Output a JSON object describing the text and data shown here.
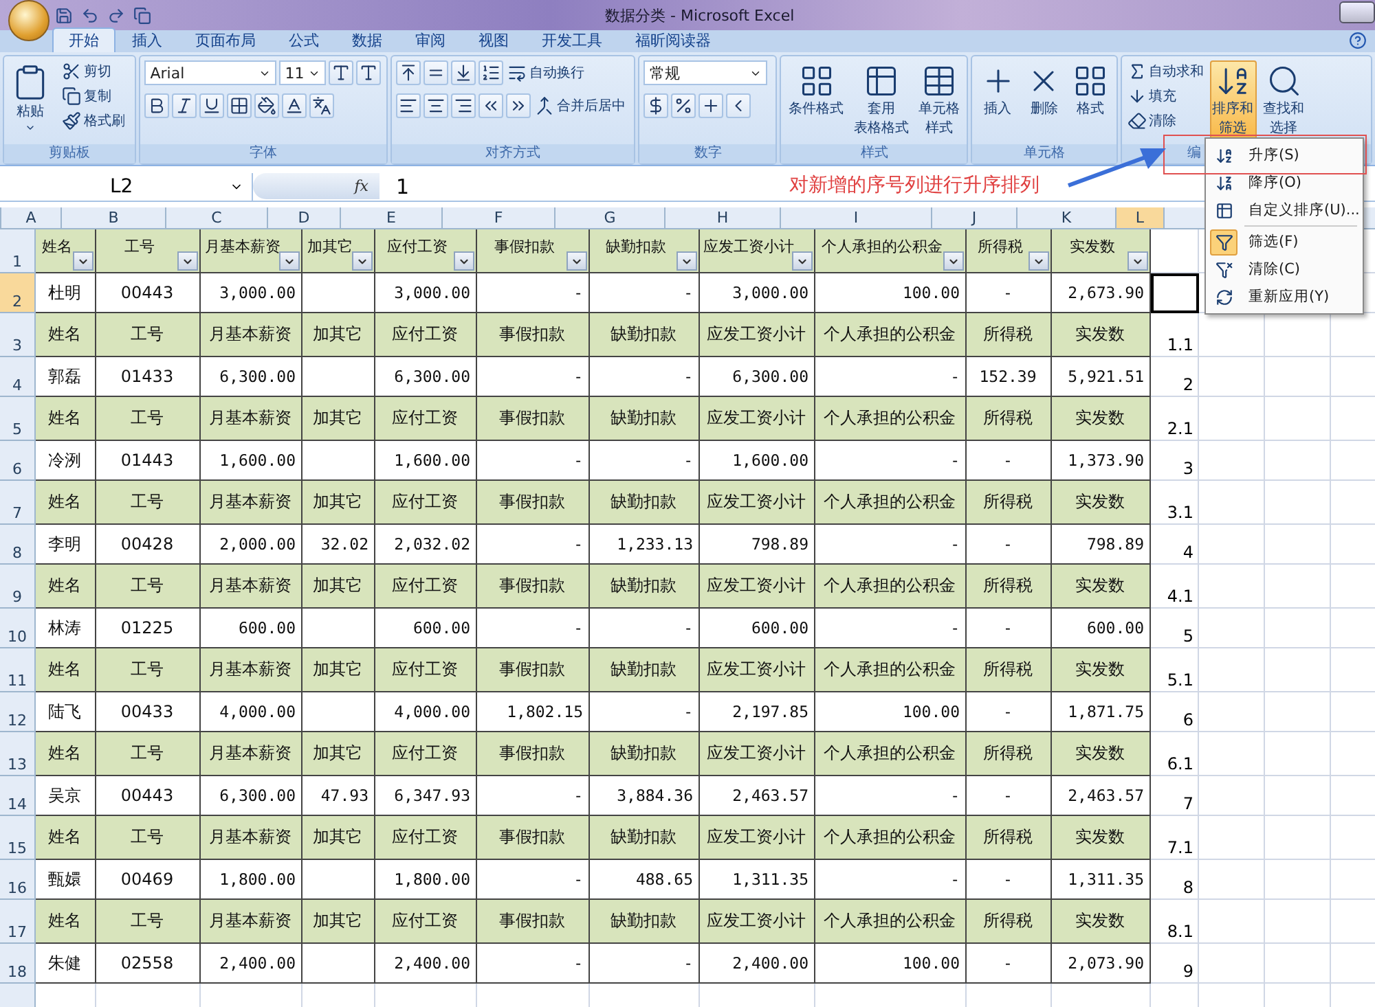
{
  "window": {
    "title": "数据分类 - Microsoft Excel"
  },
  "tabs": [
    {
      "label": "开始",
      "selected": true
    },
    {
      "label": "插入",
      "selected": false
    },
    {
      "label": "页面布局",
      "selected": false
    },
    {
      "label": "公式",
      "selected": false
    },
    {
      "label": "数据",
      "selected": false
    },
    {
      "label": "审阅",
      "selected": false
    },
    {
      "label": "视图",
      "selected": false
    },
    {
      "label": "开发工具",
      "selected": false
    },
    {
      "label": "福昕阅读器",
      "selected": false
    }
  ],
  "ribbon": [
    {
      "kind": "clipboard",
      "label": "剪贴板",
      "large": [
        "粘贴"
      ],
      "small": [
        "剪切",
        "复制",
        "格式刷"
      ]
    },
    {
      "kind": "font",
      "label": "字体",
      "font": "Arial",
      "size": "11"
    },
    {
      "kind": "alignment",
      "label": "对齐方式",
      "small": [
        "自动换行",
        "合并后居中"
      ]
    },
    {
      "kind": "number",
      "label": "数字",
      "format": "常规"
    },
    {
      "kind": "styles",
      "label": "样式",
      "large": [
        {
          "lines": [
            "条件格式"
          ],
          "active": false
        },
        {
          "lines": [
            "套用",
            "表格格式"
          ],
          "active": false
        },
        {
          "lines": [
            "单元格",
            "样式"
          ],
          "active": false
        }
      ]
    },
    {
      "kind": "cells",
      "label": "单元格",
      "large": [
        {
          "lines": [
            "插入"
          ],
          "active": false
        },
        {
          "lines": [
            "删除"
          ],
          "active": false
        },
        {
          "lines": [
            "格式"
          ],
          "active": false
        }
      ]
    },
    {
      "kind": "editing",
      "label": "编",
      "small": [
        "自动求和",
        "填充",
        "清除"
      ],
      "large": [
        {
          "lines": [
            "排序和",
            "筛选"
          ],
          "active": true
        },
        {
          "lines": [
            "查找和",
            "选择"
          ],
          "active": false
        }
      ]
    }
  ],
  "formula_bar": {
    "name_box": "L2",
    "fx_label": "fx",
    "value": "1"
  },
  "columns": [
    {
      "label": "A",
      "selected": false
    },
    {
      "label": "B",
      "selected": false
    },
    {
      "label": "C",
      "selected": false
    },
    {
      "label": "D",
      "selected": false
    },
    {
      "label": "E",
      "selected": false
    },
    {
      "label": "F",
      "selected": false
    },
    {
      "label": "G",
      "selected": false
    },
    {
      "label": "H",
      "selected": false
    },
    {
      "label": "I",
      "selected": false
    },
    {
      "label": "J",
      "selected": false
    },
    {
      "label": "K",
      "selected": false
    },
    {
      "label": "L",
      "selected": true
    }
  ],
  "rows": [
    {
      "num": "1",
      "kind": "header",
      "selected": false,
      "filters": true,
      "cells": [
        "姓名",
        "工号",
        "月基本薪资",
        "加其它",
        "应付工资",
        "事假扣款",
        "缺勤扣款",
        "应发工资小计",
        "个人承担的公积金",
        "所得税",
        "实发数"
      ],
      "l": ""
    },
    {
      "num": "2",
      "kind": "data",
      "selected": true,
      "cells": [
        "杜明",
        "00443",
        "3,000.00",
        "",
        "3,000.00",
        "-",
        "-",
        "3,000.00",
        "100.00",
        "-",
        "2,673.90"
      ],
      "l": ""
    },
    {
      "num": "3",
      "kind": "header",
      "selected": false,
      "filters": false,
      "cells": [
        "姓名",
        "工号",
        "月基本薪资",
        "加其它",
        "应付工资",
        "事假扣款",
        "缺勤扣款",
        "应发工资小计",
        "个人承担的公积金",
        "所得税",
        "实发数"
      ],
      "l": "1.1"
    },
    {
      "num": "4",
      "kind": "data",
      "selected": false,
      "cells": [
        "郭磊",
        "01433",
        "6,300.00",
        "",
        "6,300.00",
        "-",
        "-",
        "6,300.00",
        "-",
        "152.39",
        "5,921.51"
      ],
      "l": "2"
    },
    {
      "num": "5",
      "kind": "header",
      "selected": false,
      "filters": false,
      "cells": [
        "姓名",
        "工号",
        "月基本薪资",
        "加其它",
        "应付工资",
        "事假扣款",
        "缺勤扣款",
        "应发工资小计",
        "个人承担的公积金",
        "所得税",
        "实发数"
      ],
      "l": "2.1"
    },
    {
      "num": "6",
      "kind": "data",
      "selected": false,
      "cells": [
        "冷洌",
        "01443",
        "1,600.00",
        "",
        "1,600.00",
        "-",
        "-",
        "1,600.00",
        "-",
        "-",
        "1,373.90"
      ],
      "l": "3"
    },
    {
      "num": "7",
      "kind": "header",
      "selected": false,
      "filters": false,
      "cells": [
        "姓名",
        "工号",
        "月基本薪资",
        "加其它",
        "应付工资",
        "事假扣款",
        "缺勤扣款",
        "应发工资小计",
        "个人承担的公积金",
        "所得税",
        "实发数"
      ],
      "l": "3.1"
    },
    {
      "num": "8",
      "kind": "data",
      "selected": false,
      "cells": [
        "李明",
        "00428",
        "2,000.00",
        "32.02",
        "2,032.02",
        "-",
        "1,233.13",
        "798.89",
        "-",
        "-",
        "798.89"
      ],
      "l": "4"
    },
    {
      "num": "9",
      "kind": "header",
      "selected": false,
      "filters": false,
      "cells": [
        "姓名",
        "工号",
        "月基本薪资",
        "加其它",
        "应付工资",
        "事假扣款",
        "缺勤扣款",
        "应发工资小计",
        "个人承担的公积金",
        "所得税",
        "实发数"
      ],
      "l": "4.1"
    },
    {
      "num": "10",
      "kind": "data",
      "selected": false,
      "cells": [
        "林涛",
        "01225",
        "600.00",
        "",
        "600.00",
        "-",
        "-",
        "600.00",
        "-",
        "-",
        "600.00"
      ],
      "l": "5"
    },
    {
      "num": "11",
      "kind": "header",
      "selected": false,
      "filters": false,
      "cells": [
        "姓名",
        "工号",
        "月基本薪资",
        "加其它",
        "应付工资",
        "事假扣款",
        "缺勤扣款",
        "应发工资小计",
        "个人承担的公积金",
        "所得税",
        "实发数"
      ],
      "l": "5.1"
    },
    {
      "num": "12",
      "kind": "data",
      "selected": false,
      "cells": [
        "陆飞",
        "00433",
        "4,000.00",
        "",
        "4,000.00",
        "1,802.15",
        "-",
        "2,197.85",
        "100.00",
        "-",
        "1,871.75"
      ],
      "l": "6"
    },
    {
      "num": "13",
      "kind": "header",
      "selected": false,
      "filters": false,
      "cells": [
        "姓名",
        "工号",
        "月基本薪资",
        "加其它",
        "应付工资",
        "事假扣款",
        "缺勤扣款",
        "应发工资小计",
        "个人承担的公积金",
        "所得税",
        "实发数"
      ],
      "l": "6.1"
    },
    {
      "num": "14",
      "kind": "data",
      "selected": false,
      "cells": [
        "吴京",
        "00443",
        "6,300.00",
        "47.93",
        "6,347.93",
        "-",
        "3,884.36",
        "2,463.57",
        "-",
        "-",
        "2,463.57"
      ],
      "l": "7"
    },
    {
      "num": "15",
      "kind": "header",
      "selected": false,
      "filters": false,
      "cells": [
        "姓名",
        "工号",
        "月基本薪资",
        "加其它",
        "应付工资",
        "事假扣款",
        "缺勤扣款",
        "应发工资小计",
        "个人承担的公积金",
        "所得税",
        "实发数"
      ],
      "l": "7.1"
    },
    {
      "num": "16",
      "kind": "data",
      "selected": false,
      "cells": [
        "甄嬛",
        "00469",
        "1,800.00",
        "",
        "1,800.00",
        "-",
        "488.65",
        "1,311.35",
        "-",
        "-",
        "1,311.35"
      ],
      "l": "8"
    },
    {
      "num": "17",
      "kind": "header",
      "selected": false,
      "filters": false,
      "cells": [
        "姓名",
        "工号",
        "月基本薪资",
        "加其它",
        "应付工资",
        "事假扣款",
        "缺勤扣款",
        "应发工资小计",
        "个人承担的公积金",
        "所得税",
        "实发数"
      ],
      "l": "8.1"
    },
    {
      "num": "18",
      "kind": "data",
      "selected": false,
      "cells": [
        "朱健",
        "02558",
        "2,400.00",
        "",
        "2,400.00",
        "-",
        "-",
        "2,400.00",
        "100.00",
        "-",
        "2,073.90"
      ],
      "l": "9"
    }
  ],
  "menu": {
    "items": [
      {
        "label": "升序(S)",
        "checked": false,
        "separator_before": false
      },
      {
        "label": "降序(O)",
        "checked": false,
        "separator_before": false
      },
      {
        "label": "自定义排序(U)...",
        "checked": false,
        "separator_before": false
      },
      {
        "label": "筛选(F)",
        "checked": true,
        "separator_before": true
      },
      {
        "label": "清除(C)",
        "checked": false,
        "separator_before": false
      },
      {
        "label": "重新应用(Y)",
        "checked": false,
        "separator_before": false
      }
    ]
  },
  "annotation": {
    "text": "对新增的序号列进行升序排列"
  }
}
